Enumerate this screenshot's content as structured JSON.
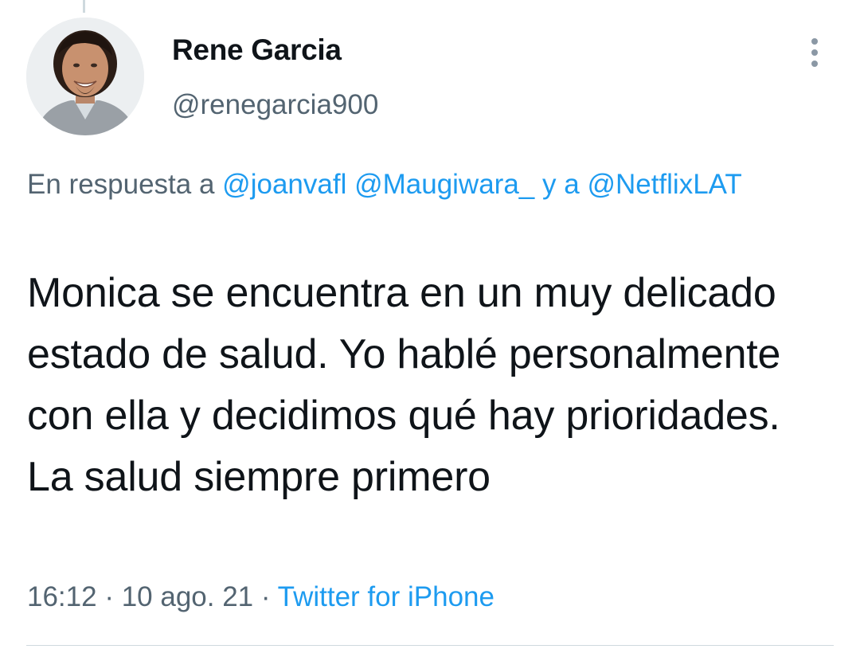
{
  "tweet": {
    "author": {
      "display_name": "Rene Garcia",
      "handle": "@renegarcia900",
      "avatar_icon": "profile-photo"
    },
    "reply_context": {
      "prefix": "En respuesta a",
      "mentions": [
        "@joanvafl",
        "@Maugiwara_",
        "@NetflixLAT"
      ],
      "conjunction": "y a"
    },
    "text": "Monica se encuentra en un muy delicado estado de salud. Yo hablé personalmente con ella y decidimos qué hay prioridades. La salud siempre primero",
    "time": "16:12",
    "date": "10 ago. 21",
    "separator": "·",
    "source": "Twitter for iPhone",
    "more_icon": "vertical-ellipsis-icon"
  },
  "colors": {
    "text_primary": "#0f1419",
    "text_secondary": "#536471",
    "link": "#1d9bf0",
    "divider": "#cfd9de"
  }
}
